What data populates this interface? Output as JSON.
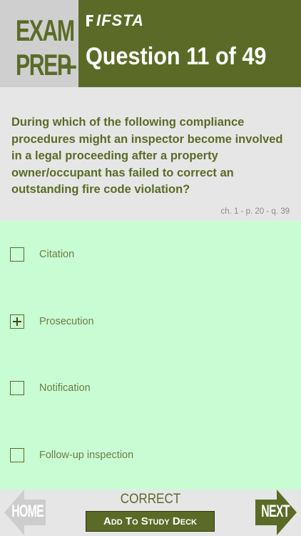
{
  "header": {
    "logo_line1": "EXAM",
    "logo_line2": "PREP",
    "logo_plus": "+",
    "brand": "IFSTA",
    "title": "Question 11 of 49"
  },
  "question": {
    "text": "During which of the following compliance procedures might an inspector become involved in a legal proceeding after a property owner/occupant has failed to correct an outstanding fire code violation?",
    "reference": "ch. 1 - p. 20 - q. 39"
  },
  "answers": [
    {
      "label": "Citation",
      "checked": false
    },
    {
      "label": "Prosecution",
      "checked": true
    },
    {
      "label": "Notification",
      "checked": false
    },
    {
      "label": "Follow-up inspection",
      "checked": false
    }
  ],
  "footer": {
    "home_label": "HOME",
    "next_label": "NEXT",
    "status": "CORRECT",
    "study_button": "Add To Study Deck"
  },
  "colors": {
    "brand_green": "#5b6b27",
    "answer_bg": "#c8fdd3",
    "header_gray": "#cfcfcf",
    "page_gray": "#e6e6e6"
  }
}
